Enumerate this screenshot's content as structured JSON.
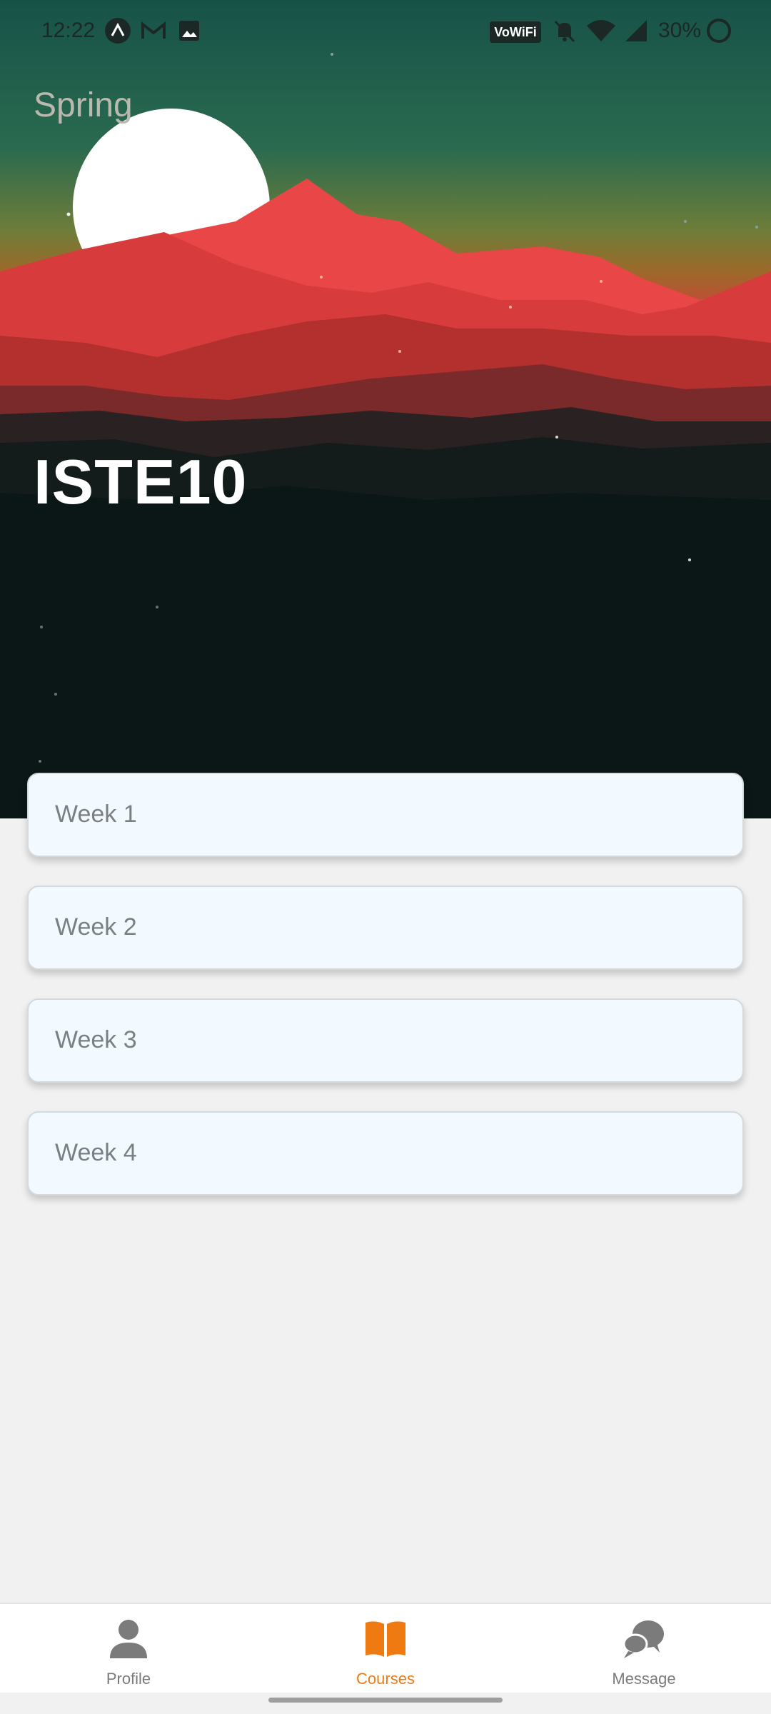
{
  "status_bar": {
    "time": "12:22",
    "wifi_badge": "VoWiFi",
    "battery": "30%",
    "icons": [
      "assistant-icon",
      "gmail-icon",
      "photo-icon",
      "vowifi-icon",
      "bell-off-icon",
      "wifi-icon",
      "signal-icon",
      "battery-icon"
    ]
  },
  "hero": {
    "season": "Spring",
    "course_code": "ISTE10"
  },
  "weeks": [
    {
      "label": "Week 1"
    },
    {
      "label": "Week 2"
    },
    {
      "label": "Week 3"
    },
    {
      "label": "Week 4"
    }
  ],
  "bottom_nav": {
    "items": [
      {
        "label": "Profile",
        "icon": "person-icon",
        "active": false
      },
      {
        "label": "Courses",
        "icon": "book-icon",
        "active": true
      },
      {
        "label": "Message",
        "icon": "chat-bubbles-icon",
        "active": false
      }
    ]
  },
  "colors": {
    "accent": "#f07a12",
    "inactive": "#7b7b7b",
    "card_bg": "#f3faff"
  }
}
